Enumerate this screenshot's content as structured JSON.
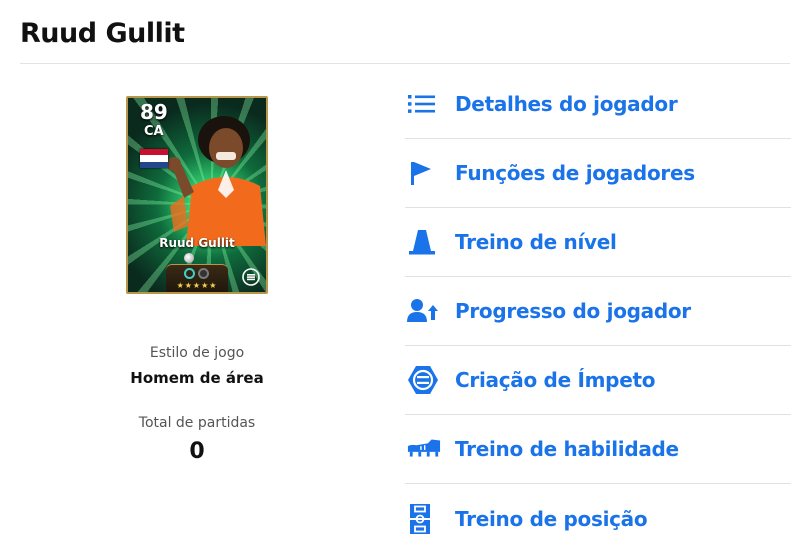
{
  "page": {
    "title": "Ruud Gullit"
  },
  "card": {
    "rating": "89",
    "position": "CA",
    "name": "Ruud Gullit",
    "flag": "netherlands-flag",
    "stars": "★★★★★"
  },
  "stats": {
    "playstyle_label": "Estilo de jogo",
    "playstyle_value": "Homem de área",
    "matches_label": "Total de partidas",
    "matches_value": "0"
  },
  "menu": {
    "accent_color": "#1a73e8",
    "items": [
      {
        "label": "Detalhes do jogador",
        "icon": "list-icon"
      },
      {
        "label": "Funções de jogadores",
        "icon": "flag-icon"
      },
      {
        "label": "Treino de nível",
        "icon": "cone-icon"
      },
      {
        "label": "Progresso do jogador",
        "icon": "person-up-icon"
      },
      {
        "label": "Criação de Ímpeto",
        "icon": "efootball-icon"
      },
      {
        "label": "Treino de habilidade",
        "icon": "boot-icon"
      },
      {
        "label": "Treino de posição",
        "icon": "pitch-icon"
      }
    ]
  }
}
